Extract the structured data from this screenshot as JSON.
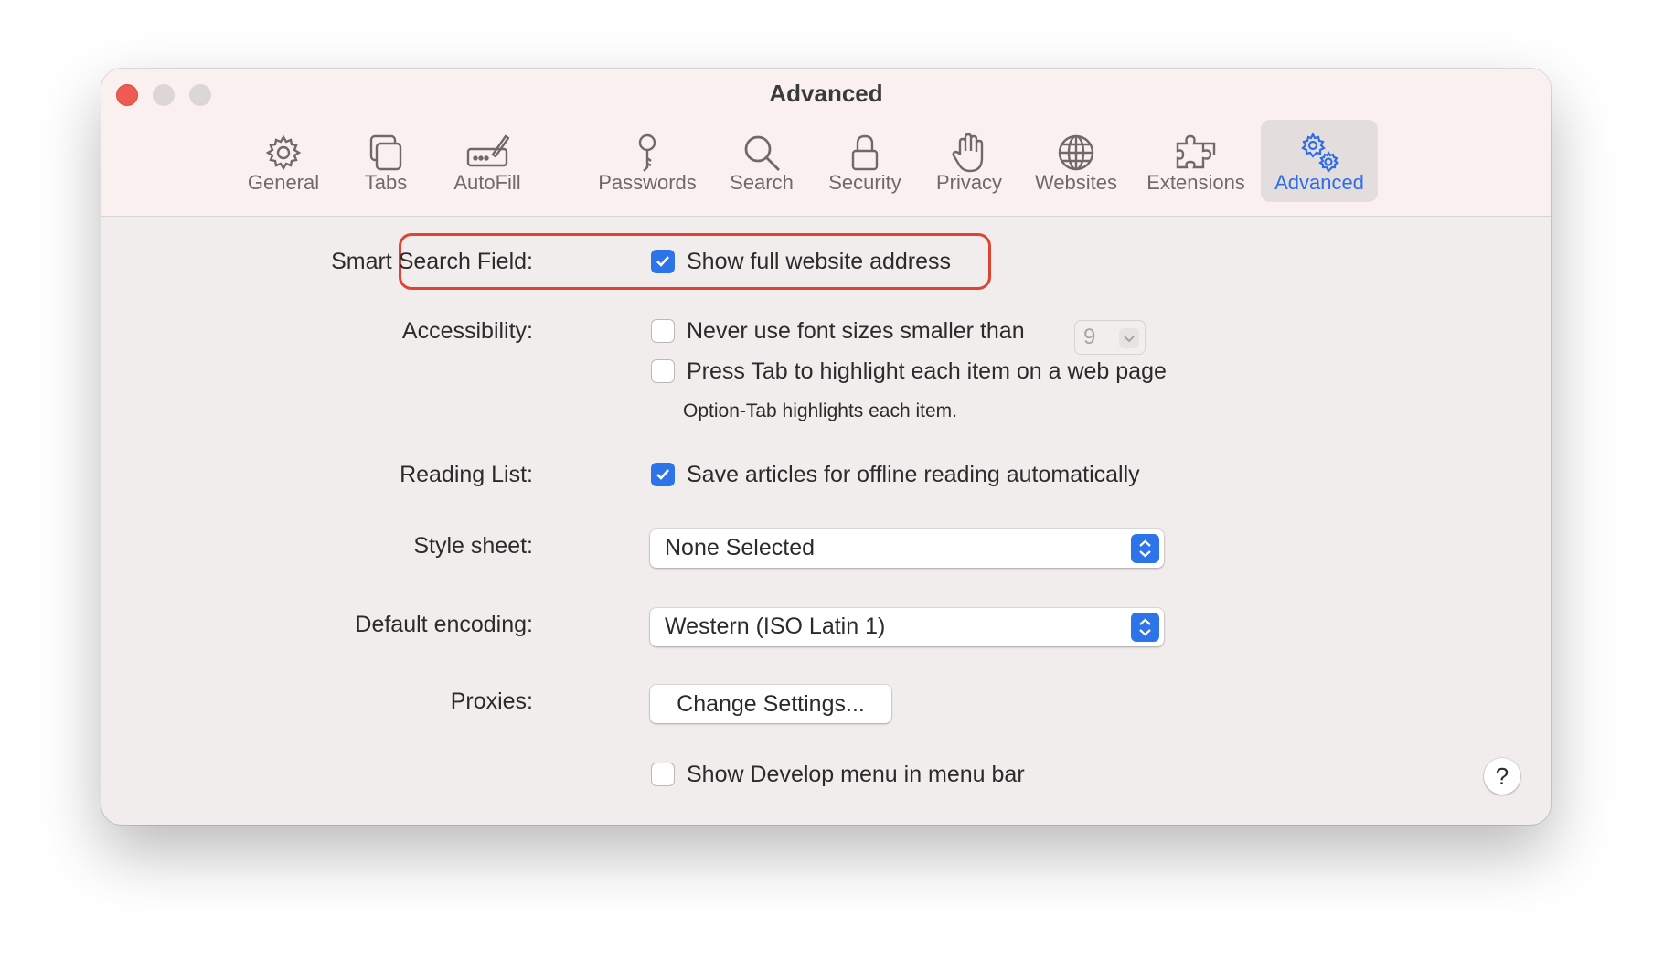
{
  "window": {
    "title": "Advanced"
  },
  "toolbar": {
    "items": [
      {
        "label": "General",
        "icon": "gear-icon"
      },
      {
        "label": "Tabs",
        "icon": "tabs-icon"
      },
      {
        "label": "AutoFill",
        "icon": "autofill-icon"
      },
      {
        "label": "Passwords",
        "icon": "key-icon"
      },
      {
        "label": "Search",
        "icon": "magnifier-icon"
      },
      {
        "label": "Security",
        "icon": "lock-icon"
      },
      {
        "label": "Privacy",
        "icon": "hand-icon"
      },
      {
        "label": "Websites",
        "icon": "globe-icon"
      },
      {
        "label": "Extensions",
        "icon": "puzzle-icon"
      },
      {
        "label": "Advanced",
        "icon": "gears-icon",
        "selected": true
      }
    ]
  },
  "settings": {
    "smart_search": {
      "label": "Smart Search Field:",
      "option": "Show full website address",
      "checked": true
    },
    "accessibility": {
      "label": "Accessibility:",
      "font_option": "Never use font sizes smaller than",
      "font_checked": false,
      "font_size": "9",
      "tab_option": "Press Tab to highlight each item on a web page",
      "tab_checked": false,
      "hint": "Option-Tab highlights each item."
    },
    "reading_list": {
      "label": "Reading List:",
      "option": "Save articles for offline reading automatically",
      "checked": true
    },
    "style_sheet": {
      "label": "Style sheet:",
      "value": "None Selected"
    },
    "encoding": {
      "label": "Default encoding:",
      "value": "Western (ISO Latin 1)"
    },
    "proxies": {
      "label": "Proxies:",
      "button": "Change Settings..."
    },
    "develop": {
      "option": "Show Develop menu in menu bar",
      "checked": false
    }
  },
  "help": {
    "label": "?"
  },
  "colors": {
    "accent": "#2d74e8",
    "highlight_outline": "#e0432f"
  }
}
